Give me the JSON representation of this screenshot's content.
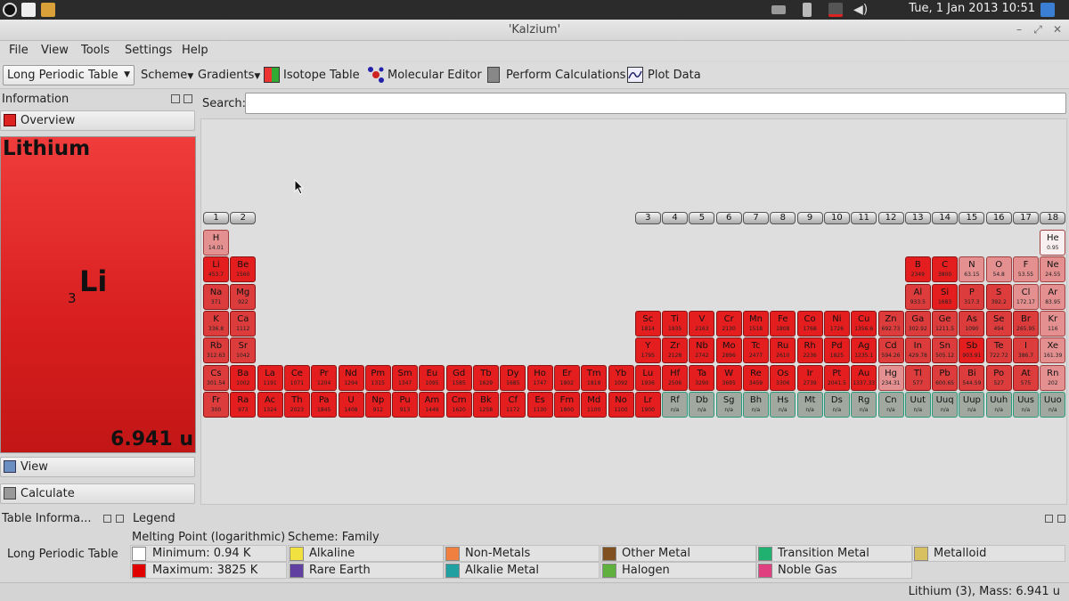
{
  "system": {
    "clock": "Tue,  1 Jan 2013 10:51"
  },
  "window": {
    "title": "'Kalzium'"
  },
  "menu": [
    "File",
    "View",
    "Tools",
    "Settings",
    "Help"
  ],
  "toolbar": {
    "table_combo": "Long Periodic Table",
    "scheme": "Scheme",
    "gradients": "Gradients",
    "isotope_table": "Isotope Table",
    "molecular_editor": "Molecular Editor",
    "perform_calculations": "Perform Calculations",
    "plot_data": "Plot Data"
  },
  "info_panel": {
    "title": "Information",
    "overview": "Overview",
    "view": "View",
    "calculate": "Calculate",
    "element": {
      "name": "Lithium",
      "symbol": "Li",
      "number": "3",
      "mass": "6.941 u"
    }
  },
  "search": {
    "label": "Search:",
    "value": ""
  },
  "groups": [
    "1",
    "2",
    "3",
    "4",
    "5",
    "6",
    "7",
    "8",
    "9",
    "10",
    "11",
    "12",
    "13",
    "14",
    "15",
    "16",
    "17",
    "18"
  ],
  "elements": [
    {
      "s": "H",
      "v": "14.01",
      "c": 1,
      "r": 1,
      "k": "l"
    },
    {
      "s": "He",
      "v": "0.95",
      "c": 18,
      "r": 1,
      "k": "w"
    },
    {
      "s": "Li",
      "v": "453.7",
      "c": 1,
      "r": 2,
      "k": "r"
    },
    {
      "s": "Be",
      "v": "1560",
      "c": 2,
      "r": 2,
      "k": "r"
    },
    {
      "s": "B",
      "v": "2349",
      "c": 13,
      "r": 2,
      "k": "r"
    },
    {
      "s": "C",
      "v": "3800",
      "c": 14,
      "r": 2,
      "k": "r"
    },
    {
      "s": "N",
      "v": "63.15",
      "c": 15,
      "r": 2,
      "k": "l"
    },
    {
      "s": "O",
      "v": "54.8",
      "c": 16,
      "r": 2,
      "k": "l"
    },
    {
      "s": "F",
      "v": "53.55",
      "c": 17,
      "r": 2,
      "k": "l"
    },
    {
      "s": "Ne",
      "v": "24.55",
      "c": 18,
      "r": 2,
      "k": "l"
    },
    {
      "s": "Na",
      "v": "371",
      "c": 1,
      "r": 3,
      "k": "m"
    },
    {
      "s": "Mg",
      "v": "922",
      "c": 2,
      "r": 3,
      "k": "m"
    },
    {
      "s": "Al",
      "v": "933.5",
      "c": 13,
      "r": 3,
      "k": "m"
    },
    {
      "s": "Si",
      "v": "1683",
      "c": 14,
      "r": 3,
      "k": "r"
    },
    {
      "s": "P",
      "v": "317.3",
      "c": 15,
      "r": 3,
      "k": "m"
    },
    {
      "s": "S",
      "v": "392.2",
      "c": 16,
      "r": 3,
      "k": "m"
    },
    {
      "s": "Cl",
      "v": "172.17",
      "c": 17,
      "r": 3,
      "k": "l"
    },
    {
      "s": "Ar",
      "v": "83.95",
      "c": 18,
      "r": 3,
      "k": "l"
    },
    {
      "s": "K",
      "v": "336.8",
      "c": 1,
      "r": 4,
      "k": "m"
    },
    {
      "s": "Ca",
      "v": "1112",
      "c": 2,
      "r": 4,
      "k": "m"
    },
    {
      "s": "Sc",
      "v": "1814",
      "c": 3,
      "r": 4,
      "k": "r"
    },
    {
      "s": "Ti",
      "v": "1935",
      "c": 4,
      "r": 4,
      "k": "r"
    },
    {
      "s": "V",
      "v": "2163",
      "c": 5,
      "r": 4,
      "k": "r"
    },
    {
      "s": "Cr",
      "v": "2130",
      "c": 6,
      "r": 4,
      "k": "r"
    },
    {
      "s": "Mn",
      "v": "1518",
      "c": 7,
      "r": 4,
      "k": "r"
    },
    {
      "s": "Fe",
      "v": "1808",
      "c": 8,
      "r": 4,
      "k": "r"
    },
    {
      "s": "Co",
      "v": "1768",
      "c": 9,
      "r": 4,
      "k": "r"
    },
    {
      "s": "Ni",
      "v": "1726",
      "c": 10,
      "r": 4,
      "k": "r"
    },
    {
      "s": "Cu",
      "v": "1356.6",
      "c": 11,
      "r": 4,
      "k": "r"
    },
    {
      "s": "Zn",
      "v": "692.73",
      "c": 12,
      "r": 4,
      "k": "m"
    },
    {
      "s": "Ga",
      "v": "302.92",
      "c": 13,
      "r": 4,
      "k": "m"
    },
    {
      "s": "Ge",
      "v": "1211.5",
      "c": 14,
      "r": 4,
      "k": "m"
    },
    {
      "s": "As",
      "v": "1090",
      "c": 15,
      "r": 4,
      "k": "m"
    },
    {
      "s": "Se",
      "v": "494",
      "c": 16,
      "r": 4,
      "k": "m"
    },
    {
      "s": "Br",
      "v": "265.95",
      "c": 17,
      "r": 4,
      "k": "m"
    },
    {
      "s": "Kr",
      "v": "116",
      "c": 18,
      "r": 4,
      "k": "l"
    },
    {
      "s": "Rb",
      "v": "312.63",
      "c": 1,
      "r": 5,
      "k": "m"
    },
    {
      "s": "Sr",
      "v": "1042",
      "c": 2,
      "r": 5,
      "k": "m"
    },
    {
      "s": "Y",
      "v": "1795",
      "c": 3,
      "r": 5,
      "k": "r"
    },
    {
      "s": "Zr",
      "v": "2128",
      "c": 4,
      "r": 5,
      "k": "r"
    },
    {
      "s": "Nb",
      "v": "2742",
      "c": 5,
      "r": 5,
      "k": "r"
    },
    {
      "s": "Mo",
      "v": "2896",
      "c": 6,
      "r": 5,
      "k": "r"
    },
    {
      "s": "Tc",
      "v": "2477",
      "c": 7,
      "r": 5,
      "k": "r"
    },
    {
      "s": "Ru",
      "v": "2610",
      "c": 8,
      "r": 5,
      "k": "r"
    },
    {
      "s": "Rh",
      "v": "2236",
      "c": 9,
      "r": 5,
      "k": "r"
    },
    {
      "s": "Pd",
      "v": "1825",
      "c": 10,
      "r": 5,
      "k": "r"
    },
    {
      "s": "Ag",
      "v": "1235.1",
      "c": 11,
      "r": 5,
      "k": "r"
    },
    {
      "s": "Cd",
      "v": "594.26",
      "c": 12,
      "r": 5,
      "k": "m"
    },
    {
      "s": "In",
      "v": "429.78",
      "c": 13,
      "r": 5,
      "k": "m"
    },
    {
      "s": "Sn",
      "v": "505.12",
      "c": 14,
      "r": 5,
      "k": "m"
    },
    {
      "s": "Sb",
      "v": "903.91",
      "c": 15,
      "r": 5,
      "k": "r"
    },
    {
      "s": "Te",
      "v": "722.72",
      "c": 16,
      "r": 5,
      "k": "m"
    },
    {
      "s": "I",
      "v": "386.7",
      "c": 17,
      "r": 5,
      "k": "m"
    },
    {
      "s": "Xe",
      "v": "161.39",
      "c": 18,
      "r": 5,
      "k": "l"
    },
    {
      "s": "Cs",
      "v": "301.54",
      "c": 1,
      "r": 6,
      "k": "m"
    },
    {
      "s": "Ba",
      "v": "1002",
      "c": 2,
      "r": 6,
      "k": "r"
    },
    {
      "s": "La",
      "v": "1191",
      "c": 3,
      "r": 6,
      "k": "r",
      "x": 0
    },
    {
      "s": "Ce",
      "v": "1071",
      "c": 3,
      "r": 6,
      "k": "r",
      "x": 1
    },
    {
      "s": "Pr",
      "v": "1204",
      "c": 3,
      "r": 6,
      "k": "r",
      "x": 2
    },
    {
      "s": "Nd",
      "v": "1294",
      "c": 3,
      "r": 6,
      "k": "r",
      "x": 3
    },
    {
      "s": "Pm",
      "v": "1315",
      "c": 3,
      "r": 6,
      "k": "r",
      "x": 4
    },
    {
      "s": "Sm",
      "v": "1347",
      "c": 3,
      "r": 6,
      "k": "r",
      "x": 5
    },
    {
      "s": "Eu",
      "v": "1095",
      "c": 3,
      "r": 6,
      "k": "r",
      "x": 6
    },
    {
      "s": "Gd",
      "v": "1585",
      "c": 3,
      "r": 6,
      "k": "r",
      "x": 7
    },
    {
      "s": "Tb",
      "v": "1629",
      "c": 3,
      "r": 6,
      "k": "r",
      "x": 8
    },
    {
      "s": "Dy",
      "v": "1685",
      "c": 3,
      "r": 6,
      "k": "r",
      "x": 9
    },
    {
      "s": "Ho",
      "v": "1747",
      "c": 3,
      "r": 6,
      "k": "r",
      "x": 10
    },
    {
      "s": "Er",
      "v": "1802",
      "c": 3,
      "r": 6,
      "k": "r",
      "x": 11
    },
    {
      "s": "Tm",
      "v": "1818",
      "c": 3,
      "r": 6,
      "k": "r",
      "x": 12
    },
    {
      "s": "Yb",
      "v": "1092",
      "c": 3,
      "r": 6,
      "k": "r",
      "x": 13
    },
    {
      "s": "Lu",
      "v": "1936",
      "c": 3,
      "r": 6,
      "k": "r",
      "x": 14
    },
    {
      "s": "Hf",
      "v": "2506",
      "c": 4,
      "r": 6,
      "k": "r"
    },
    {
      "s": "Ta",
      "v": "3290",
      "c": 5,
      "r": 6,
      "k": "r"
    },
    {
      "s": "W",
      "v": "3695",
      "c": 6,
      "r": 6,
      "k": "r"
    },
    {
      "s": "Re",
      "v": "3459",
      "c": 7,
      "r": 6,
      "k": "r"
    },
    {
      "s": "Os",
      "v": "3306",
      "c": 8,
      "r": 6,
      "k": "r"
    },
    {
      "s": "Ir",
      "v": "2739",
      "c": 9,
      "r": 6,
      "k": "r"
    },
    {
      "s": "Pt",
      "v": "2041.5",
      "c": 10,
      "r": 6,
      "k": "r"
    },
    {
      "s": "Au",
      "v": "1337.33",
      "c": 11,
      "r": 6,
      "k": "r"
    },
    {
      "s": "Hg",
      "v": "234.31",
      "c": 12,
      "r": 6,
      "k": "l"
    },
    {
      "s": "Tl",
      "v": "577",
      "c": 13,
      "r": 6,
      "k": "m"
    },
    {
      "s": "Pb",
      "v": "600.65",
      "c": 14,
      "r": 6,
      "k": "m"
    },
    {
      "s": "Bi",
      "v": "544.59",
      "c": 15,
      "r": 6,
      "k": "m"
    },
    {
      "s": "Po",
      "v": "527",
      "c": 16,
      "r": 6,
      "k": "m"
    },
    {
      "s": "At",
      "v": "575",
      "c": 17,
      "r": 6,
      "k": "m"
    },
    {
      "s": "Rn",
      "v": "202",
      "c": 18,
      "r": 6,
      "k": "l"
    },
    {
      "s": "Fr",
      "v": "300",
      "c": 1,
      "r": 7,
      "k": "m"
    },
    {
      "s": "Ra",
      "v": "973",
      "c": 2,
      "r": 7,
      "k": "r"
    },
    {
      "s": "Ac",
      "v": "1324",
      "c": 3,
      "r": 7,
      "k": "r",
      "x": 0
    },
    {
      "s": "Th",
      "v": "2023",
      "c": 3,
      "r": 7,
      "k": "r",
      "x": 1
    },
    {
      "s": "Pa",
      "v": "1845",
      "c": 3,
      "r": 7,
      "k": "r",
      "x": 2
    },
    {
      "s": "U",
      "v": "1408",
      "c": 3,
      "r": 7,
      "k": "r",
      "x": 3
    },
    {
      "s": "Np",
      "v": "912",
      "c": 3,
      "r": 7,
      "k": "r",
      "x": 4
    },
    {
      "s": "Pu",
      "v": "913",
      "c": 3,
      "r": 7,
      "k": "r",
      "x": 5
    },
    {
      "s": "Am",
      "v": "1449",
      "c": 3,
      "r": 7,
      "k": "r",
      "x": 6
    },
    {
      "s": "Cm",
      "v": "1620",
      "c": 3,
      "r": 7,
      "k": "r",
      "x": 7
    },
    {
      "s": "Bk",
      "v": "1258",
      "c": 3,
      "r": 7,
      "k": "r",
      "x": 8
    },
    {
      "s": "Cf",
      "v": "1172",
      "c": 3,
      "r": 7,
      "k": "r",
      "x": 9
    },
    {
      "s": "Es",
      "v": "1130",
      "c": 3,
      "r": 7,
      "k": "r",
      "x": 10
    },
    {
      "s": "Fm",
      "v": "1800",
      "c": 3,
      "r": 7,
      "k": "r",
      "x": 11
    },
    {
      "s": "Md",
      "v": "1100",
      "c": 3,
      "r": 7,
      "k": "r",
      "x": 12
    },
    {
      "s": "No",
      "v": "1100",
      "c": 3,
      "r": 7,
      "k": "r",
      "x": 13
    },
    {
      "s": "Lr",
      "v": "1900",
      "c": 3,
      "r": 7,
      "k": "r",
      "x": 14
    },
    {
      "s": "Rf",
      "v": "n/a",
      "c": 4,
      "r": 7,
      "k": "g"
    },
    {
      "s": "Db",
      "v": "n/a",
      "c": 5,
      "r": 7,
      "k": "g"
    },
    {
      "s": "Sg",
      "v": "n/a",
      "c": 6,
      "r": 7,
      "k": "g"
    },
    {
      "s": "Bh",
      "v": "n/a",
      "c": 7,
      "r": 7,
      "k": "g"
    },
    {
      "s": "Hs",
      "v": "n/a",
      "c": 8,
      "r": 7,
      "k": "g"
    },
    {
      "s": "Mt",
      "v": "n/a",
      "c": 9,
      "r": 7,
      "k": "g"
    },
    {
      "s": "Ds",
      "v": "n/a",
      "c": 10,
      "r": 7,
      "k": "g"
    },
    {
      "s": "Rg",
      "v": "n/a",
      "c": 11,
      "r": 7,
      "k": "g"
    },
    {
      "s": "Cn",
      "v": "n/a",
      "c": 12,
      "r": 7,
      "k": "g"
    },
    {
      "s": "Uut",
      "v": "n/a",
      "c": 13,
      "r": 7,
      "k": "g"
    },
    {
      "s": "Uuq",
      "v": "n/a",
      "c": 14,
      "r": 7,
      "k": "g"
    },
    {
      "s": "Uup",
      "v": "n/a",
      "c": 15,
      "r": 7,
      "k": "g"
    },
    {
      "s": "Uuh",
      "v": "n/a",
      "c": 16,
      "r": 7,
      "k": "g"
    },
    {
      "s": "Uus",
      "v": "n/a",
      "c": 17,
      "r": 7,
      "k": "g"
    },
    {
      "s": "Uuo",
      "v": "n/a",
      "c": 18,
      "r": 7,
      "k": "g"
    }
  ],
  "element_colors": {
    "r": "#e41e1e",
    "m": "#dc3c3c",
    "l": "#e49090",
    "w": "#f8f0f0",
    "g": "#a0a8a0"
  },
  "table_info": {
    "title": "Table Informa...",
    "value": "Long Periodic Table"
  },
  "legend": {
    "title": "Legend",
    "gradient_title": "Melting Point (logarithmic)",
    "scheme_title": "Scheme: Family",
    "min": "Minimum: 0.94 K",
    "max": "Maximum: 3825 K",
    "min_color": "#ffffff",
    "max_color": "#e00000",
    "items": [
      {
        "label": "Alkaline",
        "color": "#f0e040"
      },
      {
        "label": "Rare Earth",
        "color": "#6040a0"
      },
      {
        "label": "Non-Metals",
        "color": "#f08040"
      },
      {
        "label": "Alkalie Metal",
        "color": "#20a0a0"
      },
      {
        "label": "Other Metal",
        "color": "#805020"
      },
      {
        "label": "Halogen",
        "color": "#60b040"
      },
      {
        "label": "Transition Metal",
        "color": "#20b070"
      },
      {
        "label": "Noble Gas",
        "color": "#e04080"
      },
      {
        "label": "Metalloid",
        "color": "#d8c060"
      }
    ]
  },
  "status": "Lithium (3), Mass: 6.941 u"
}
